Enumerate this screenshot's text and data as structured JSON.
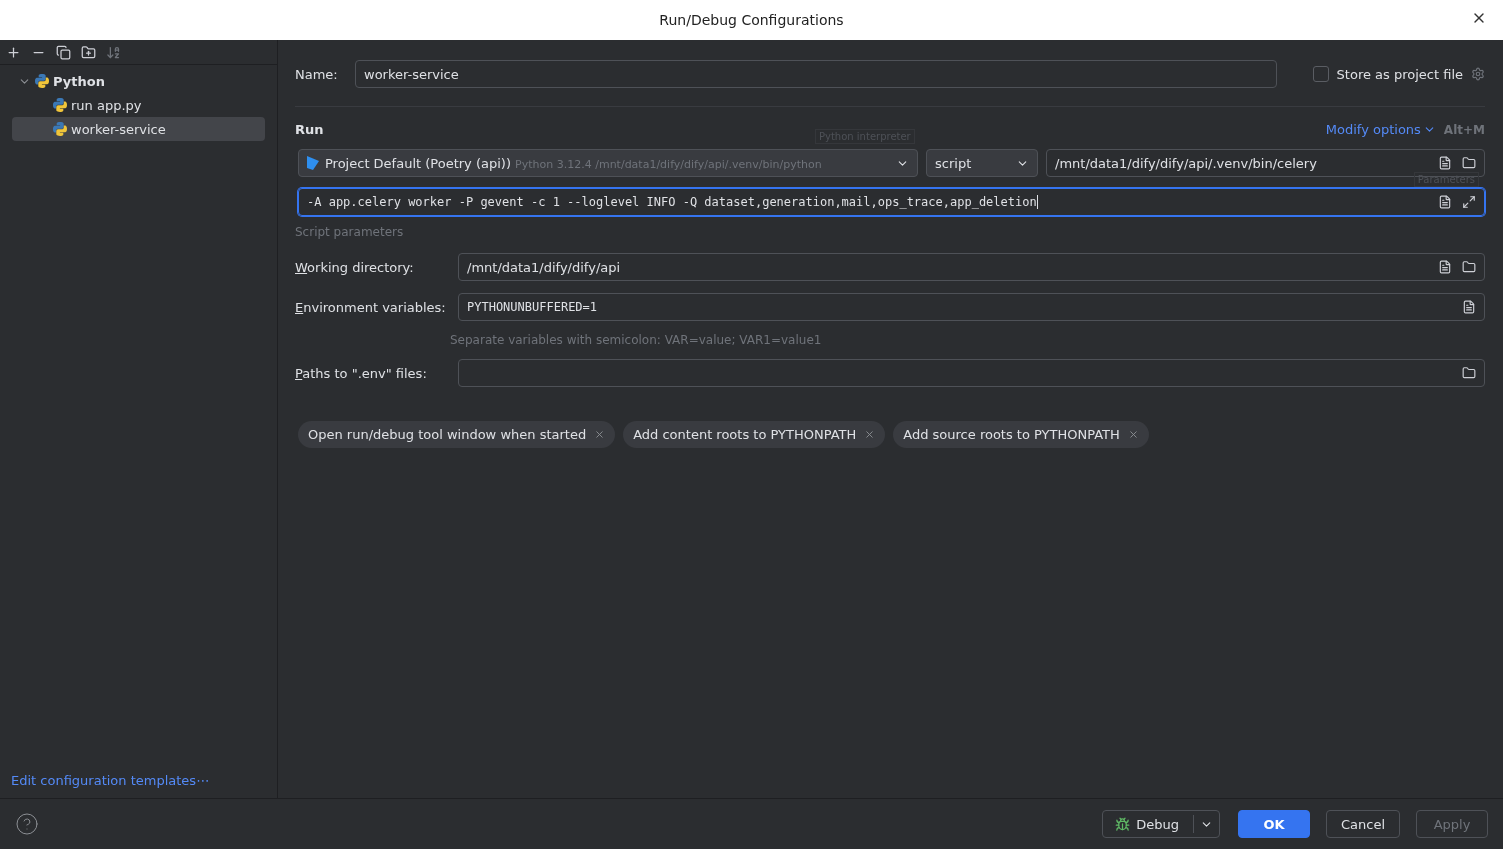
{
  "window": {
    "title": "Run/Debug Configurations"
  },
  "sidebar": {
    "tree": [
      {
        "label": "Python",
        "expanded": true,
        "selected": false,
        "children": [
          {
            "label": "run app.py",
            "selected": false
          },
          {
            "label": "worker-service",
            "selected": true
          }
        ]
      }
    ],
    "footer_link": "Edit configuration templates⋯"
  },
  "name_field": {
    "label": "Name:",
    "value": "worker-service"
  },
  "store_as_project_file": {
    "label": "Store as project file",
    "checked": false
  },
  "run_section": {
    "title": "Run",
    "modify_options": "Modify options",
    "shortcut": "Alt+M",
    "interpreter": {
      "name": "Project Default (Poetry (api))",
      "detail": "Python 3.12.4 /mnt/data1/dify/dify/api/.venv/bin/python",
      "tooltip": "Python interpreter"
    },
    "target_type": "script",
    "script_path": "/mnt/data1/dify/dify/api/.venv/bin/celery",
    "parameters": {
      "value": "-A app.celery worker -P gevent -c 1 --loglevel INFO -Q dataset,generation,mail,ops_trace,app_deletion",
      "tooltip": "Parameters",
      "hint": "Script parameters"
    }
  },
  "fields": [
    {
      "label": "Working directory:",
      "value": "/mnt/data1/dify/dify/api",
      "kind": "folder",
      "mono": false
    },
    {
      "label": "Environment variables:",
      "value": "PYTHONUNBUFFERED=1",
      "kind": "list",
      "mono": true,
      "hint": "Separate variables with semicolon: VAR=value; VAR1=value1"
    },
    {
      "label": "Paths to \".env\" files:",
      "kind": "folder_only"
    }
  ],
  "option_chips": [
    "Open run/debug tool window when started",
    "Add content roots to PYTHONPATH",
    "Add source roots to PYTHONPATH"
  ],
  "buttons": [
    {
      "label": "Debug",
      "kind": "split"
    },
    {
      "label": "OK",
      "kind": "primary",
      "disabled": false
    },
    {
      "label": "Cancel",
      "kind": "normal",
      "disabled": false
    },
    {
      "label": "Apply",
      "kind": "normal",
      "disabled": true
    }
  ]
}
